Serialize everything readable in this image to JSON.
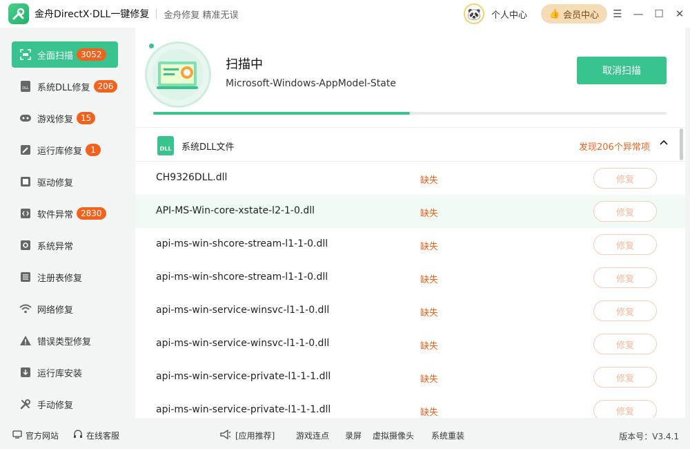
{
  "app": {
    "title": "金舟DirectX·DLL一键修复",
    "slogan": "金舟修复 精准无误"
  },
  "header": {
    "user_center": "个人中心",
    "vip_center": "会员中心"
  },
  "sidebar": {
    "items": [
      {
        "label": "全面扫描",
        "badge": "3052",
        "icon": "scan-icon",
        "active": true
      },
      {
        "label": "系统DLL修复",
        "badge": "206",
        "icon": "dll-icon"
      },
      {
        "label": "游戏修复",
        "badge": "15",
        "icon": "gamepad-icon"
      },
      {
        "label": "运行库修复",
        "badge": "1",
        "icon": "runtime-icon"
      },
      {
        "label": "驱动修复",
        "badge": "",
        "icon": "driver-icon"
      },
      {
        "label": "软件异常",
        "badge": "2830",
        "icon": "software-icon"
      },
      {
        "label": "系统异常",
        "badge": "",
        "icon": "system-gear-icon"
      },
      {
        "label": "注册表修复",
        "badge": "",
        "icon": "registry-icon"
      },
      {
        "label": "网络修复",
        "badge": "",
        "icon": "wifi-icon"
      },
      {
        "label": "错误类型修复",
        "badge": "",
        "icon": "warning-icon"
      },
      {
        "label": "运行库安装",
        "badge": "",
        "icon": "install-icon"
      },
      {
        "label": "手动修复",
        "badge": "",
        "icon": "tools-icon"
      }
    ]
  },
  "scan": {
    "status": "扫描中",
    "current_file": "Microsoft-Windows-AppModel-State",
    "cancel_label": "取消扫描",
    "progress": 0.5
  },
  "section": {
    "title": "系统DLL文件",
    "found": "发现206个异常项"
  },
  "files": [
    {
      "name": "CH9326DLL.dll",
      "status": "缺失",
      "action": "修复"
    },
    {
      "name": "API-MS-Win-core-xstate-l2-1-0.dll",
      "status": "缺失",
      "action": "修复"
    },
    {
      "name": "api-ms-win-shcore-stream-l1-1-0.dll",
      "status": "缺失",
      "action": "修复"
    },
    {
      "name": "api-ms-win-shcore-stream-l1-1-0.dll",
      "status": "缺失",
      "action": "修复"
    },
    {
      "name": "api-ms-win-service-winsvc-l1-1-0.dll",
      "status": "缺失",
      "action": "修复"
    },
    {
      "name": "api-ms-win-service-winsvc-l1-1-0.dll",
      "status": "缺失",
      "action": "修复"
    },
    {
      "name": "api-ms-win-service-private-l1-1-1.dll",
      "status": "缺失",
      "action": "修复"
    },
    {
      "name": "api-ms-win-service-private-l1-1-1.dll",
      "status": "缺失",
      "action": "修复"
    }
  ],
  "footer": {
    "official_site": "官方网站",
    "online_support": "在线客服",
    "recommend": "[应用推荐]",
    "links": [
      "游戏连点",
      "录屏",
      "虚拟摄像头",
      "系统重装"
    ],
    "version": "版本号：V3.4.1"
  },
  "colors": {
    "accent": "#38c38f",
    "badge": "#f2621c",
    "warning_text": "#f2621c"
  }
}
